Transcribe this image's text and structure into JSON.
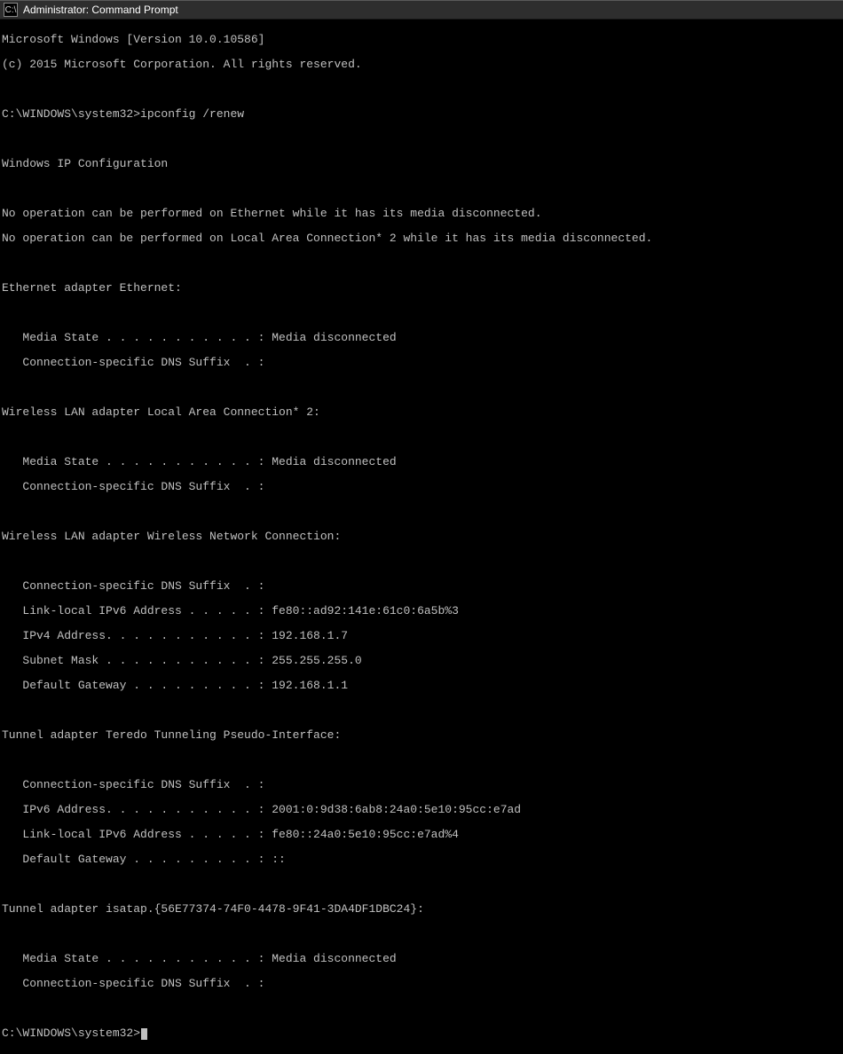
{
  "titlebar": {
    "icon_glyph": "C:\\",
    "title": "Administrator: Command Prompt"
  },
  "console": {
    "version_line": "Microsoft Windows [Version 10.0.10586]",
    "copyright_line": "(c) 2015 Microsoft Corporation. All rights reserved.",
    "prompt1": "C:\\WINDOWS\\system32>",
    "command1": "ipconfig /renew",
    "header": "Windows IP Configuration",
    "noop1": "No operation can be performed on Ethernet while it has its media disconnected.",
    "noop2": "No operation can be performed on Local Area Connection* 2 while it has its media disconnected.",
    "adapter1": {
      "title": "Ethernet adapter Ethernet:",
      "media_state": "   Media State . . . . . . . . . . . : Media disconnected",
      "dns_suffix": "   Connection-specific DNS Suffix  . :"
    },
    "adapter2": {
      "title": "Wireless LAN adapter Local Area Connection* 2:",
      "media_state": "   Media State . . . . . . . . . . . : Media disconnected",
      "dns_suffix": "   Connection-specific DNS Suffix  . :"
    },
    "adapter3": {
      "title": "Wireless LAN adapter Wireless Network Connection:",
      "dns_suffix": "   Connection-specific DNS Suffix  . :",
      "link_local": "   Link-local IPv6 Address . . . . . : fe80::ad92:141e:61c0:6a5b%3",
      "ipv4": "   IPv4 Address. . . . . . . . . . . : 192.168.1.7",
      "subnet": "   Subnet Mask . . . . . . . . . . . : 255.255.255.0",
      "gateway": "   Default Gateway . . . . . . . . . : 192.168.1.1"
    },
    "adapter4": {
      "title": "Tunnel adapter Teredo Tunneling Pseudo-Interface:",
      "dns_suffix": "   Connection-specific DNS Suffix  . :",
      "ipv6": "   IPv6 Address. . . . . . . . . . . : 2001:0:9d38:6ab8:24a0:5e10:95cc:e7ad",
      "link_local": "   Link-local IPv6 Address . . . . . : fe80::24a0:5e10:95cc:e7ad%4",
      "gateway": "   Default Gateway . . . . . . . . . : ::"
    },
    "adapter5": {
      "title": "Tunnel adapter isatap.{56E77374-74F0-4478-9F41-3DA4DF1DBC24}:",
      "media_state": "   Media State . . . . . . . . . . . : Media disconnected",
      "dns_suffix": "   Connection-specific DNS Suffix  . :"
    },
    "prompt2": "C:\\WINDOWS\\system32>"
  }
}
